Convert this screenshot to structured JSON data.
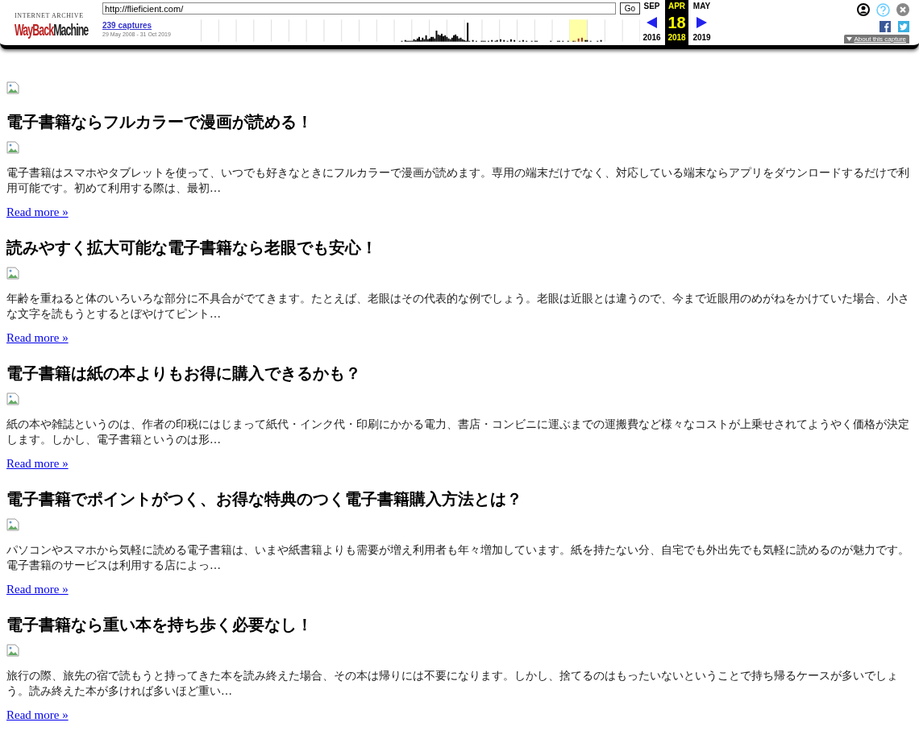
{
  "toolbar": {
    "logo": {
      "caption": "INTERNET ARCHIVE",
      "wordmark": [
        "WayBack",
        "Machine"
      ]
    },
    "url": "http://flieficient.com/",
    "go": "Go",
    "captures": "239 captures",
    "date_range": "29 May 2008 - 31 Oct 2019",
    "calendar": [
      {
        "month": "SEP",
        "year": "2016",
        "selected": false
      },
      {
        "month": "APR",
        "day": "18",
        "year": "2018",
        "selected": true
      },
      {
        "month": "MAY",
        "year": "2019",
        "selected": false
      }
    ],
    "about": "About this capture"
  },
  "articles": [
    {
      "title": "電子書籍ならフルカラーで漫画が読める！",
      "excerpt": "電子書籍はスマホやタブレットを使って、いつでも好きなときにフルカラーで漫画が読めます。専用の端末だけでなく、対応している端末ならアプリをダウンロードするだけで利用可能です。初めて利用する際は、最初…",
      "link": "Read more »"
    },
    {
      "title": "読みやすく拡大可能な電子書籍なら老眼でも安心！",
      "excerpt": "年齢を重ねると体のいろいろな部分に不具合がでてきます。たとえば、老眼はその代表的な例でしょう。老眼は近眼とは違うので、今まで近眼用のめがねをかけていた場合、小さな文字を読もうとするとぼやけてピント…",
      "link": "Read more »"
    },
    {
      "title": "電子書籍は紙の本よりもお得に購入できるかも？",
      "excerpt": "紙の本や雑誌というのは、作者の印税にはじまって紙代・インク代・印刷にかかる電力、書店・コンビニに運ぶまでの運搬費など様々なコストが上乗せされてようやく価格が決定します。しかし、電子書籍というのは形…",
      "link": "Read more »"
    },
    {
      "title": "電子書籍でポイントがつく、お得な特典のつく電子書籍購入方法とは？",
      "excerpt": "パソコンやスマホから気軽に読める電子書籍は、いまや紙書籍よりも需要が増え利用者も年々増加しています。紙を持たない分、自宅でも外出先でも気軽に読めるのが魅力です。電子書籍のサービスは利用する店によっ…",
      "link": "Read more »"
    },
    {
      "title": "電子書籍なら重い本を持ち歩く必要なし！",
      "excerpt": "旅行の際、旅先の宿で読もうと持ってきた本を読み終えた場合、その本は帰りには不要になります。しかし、捨てるのはもったいないということで持ち帰るケースが多いでしょう。読み終えた本が多ければ多いほど重い…",
      "link": "Read more »"
    }
  ]
}
